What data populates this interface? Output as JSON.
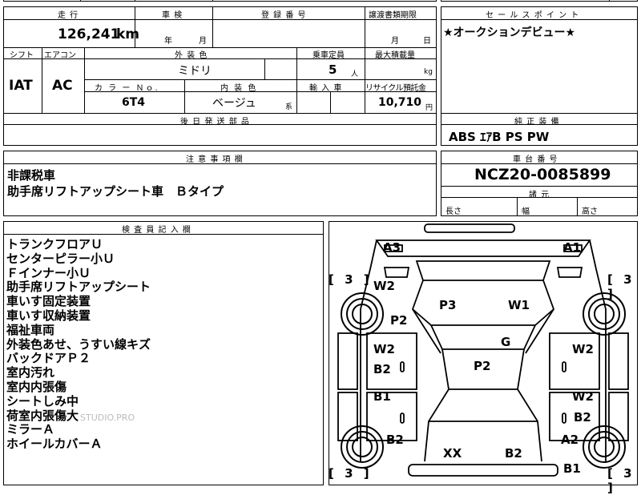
{
  "top_partial": {
    "col1": "",
    "col2": "",
    "col3": ""
  },
  "mileage": {
    "label": "走 行",
    "value": "126,241",
    "unit": "km"
  },
  "inspection": {
    "label": "車 検",
    "year": "年",
    "month": "月"
  },
  "registration": {
    "label": "登 録 番 号",
    "value": ""
  },
  "transfer_docs": {
    "label": "譲渡書類期限",
    "month": "月",
    "day": "日"
  },
  "sales_point": {
    "label": "セ ー ル ス ポ イ ン ト",
    "text": "★オークションデビュー★"
  },
  "shift": {
    "label": "シフト",
    "value": "IAT"
  },
  "aircon": {
    "label": "エアコン",
    "value": "AC"
  },
  "exterior_color": {
    "label": "外 装 色",
    "value": "ミドリ"
  },
  "capacity": {
    "label": "乗車定員",
    "value": "5",
    "unit": "人"
  },
  "max_load": {
    "label": "最大積載量",
    "value": "",
    "unit": "kg"
  },
  "color_no": {
    "label": "カ ラ ー Ｎｏ.",
    "value": "6T4"
  },
  "interior_color": {
    "label": "内 装 色",
    "value": "ベージュ",
    "suffix": "系"
  },
  "import": {
    "label": "輸 入 車",
    "value": ""
  },
  "recycle_fee": {
    "label": "リサイクル預託金",
    "value": "10,710",
    "unit": "円"
  },
  "later_parts": {
    "label": "後 日 発 送 部 品",
    "value": ""
  },
  "genuine_equipment": {
    "label": "純 正 装 備",
    "value": "ABS ｴｱB PS PW"
  },
  "notes": {
    "label": "注 意 事 項 欄",
    "lines": [
      "非課税車",
      "助手席リフトアップシート車　Ｂタイプ"
    ]
  },
  "chassis": {
    "label": "車 台 番 号",
    "value": "NCZ20-0085899"
  },
  "dimensions": {
    "label": "諸 元",
    "length": "長さ",
    "width": "幅",
    "height": "高さ"
  },
  "inspector": {
    "label": "検 査 員 記 入 欄",
    "lines": [
      "トランクフロアＵ",
      "センターピラー小Ｕ",
      "Ｆインナー小Ｕ",
      "助手席リフトアップシート",
      "車いす固定装置",
      "車いす収納装置",
      "福祉車両",
      "外装色あせ、うすい線キズ",
      "バックドアＰ２",
      "室内汚れ",
      "室内内張傷",
      "シートしみ中",
      "荷室内張傷大",
      "ミラーＡ",
      "ホイールカバーＡ"
    ]
  },
  "watermark": "STUDIO.PRO",
  "diagram": {
    "marks": [
      "A3",
      "A1",
      "W2",
      "P3",
      "W1",
      "P2",
      "G",
      "W2",
      "P2",
      "W2",
      "B2",
      "B1",
      "W2",
      "B2",
      "B2",
      "A2",
      "XX",
      "B2",
      "B1"
    ],
    "brackets": [
      "[ 3 ]",
      "[ 3 ]",
      "[ 3 ]",
      "[ 3 ]"
    ]
  }
}
